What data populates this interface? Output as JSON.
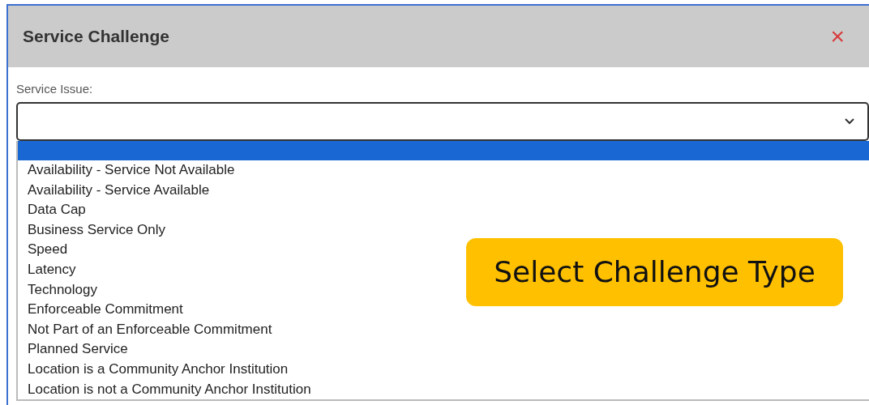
{
  "dialog": {
    "title": "Service Challenge",
    "close": "×"
  },
  "field": {
    "label": "Service Issue:"
  },
  "options": [
    {
      "selected": true
    },
    {
      "label": "Availability - Service Not Available",
      "selected": false
    },
    {
      "label": "Availability - Service Available",
      "selected": false
    },
    {
      "label": "Data Cap",
      "selected": false
    },
    {
      "label": "Business Service Only",
      "selected": false
    },
    {
      "label": "Speed",
      "selected": false
    },
    {
      "label": "Latency",
      "selected": false
    },
    {
      "label": "Technology",
      "selected": false
    },
    {
      "label": "Enforceable Commitment",
      "selected": false
    },
    {
      "label": "Not Part of an Enforceable Commitment",
      "selected": false
    },
    {
      "label": "Planned Service",
      "selected": false
    },
    {
      "label": "Location is a Community Anchor Institution",
      "selected": false
    },
    {
      "label": "Location is not a Community Anchor Institution",
      "selected": false
    }
  ],
  "callout": {
    "text": "Select Challenge Type"
  }
}
